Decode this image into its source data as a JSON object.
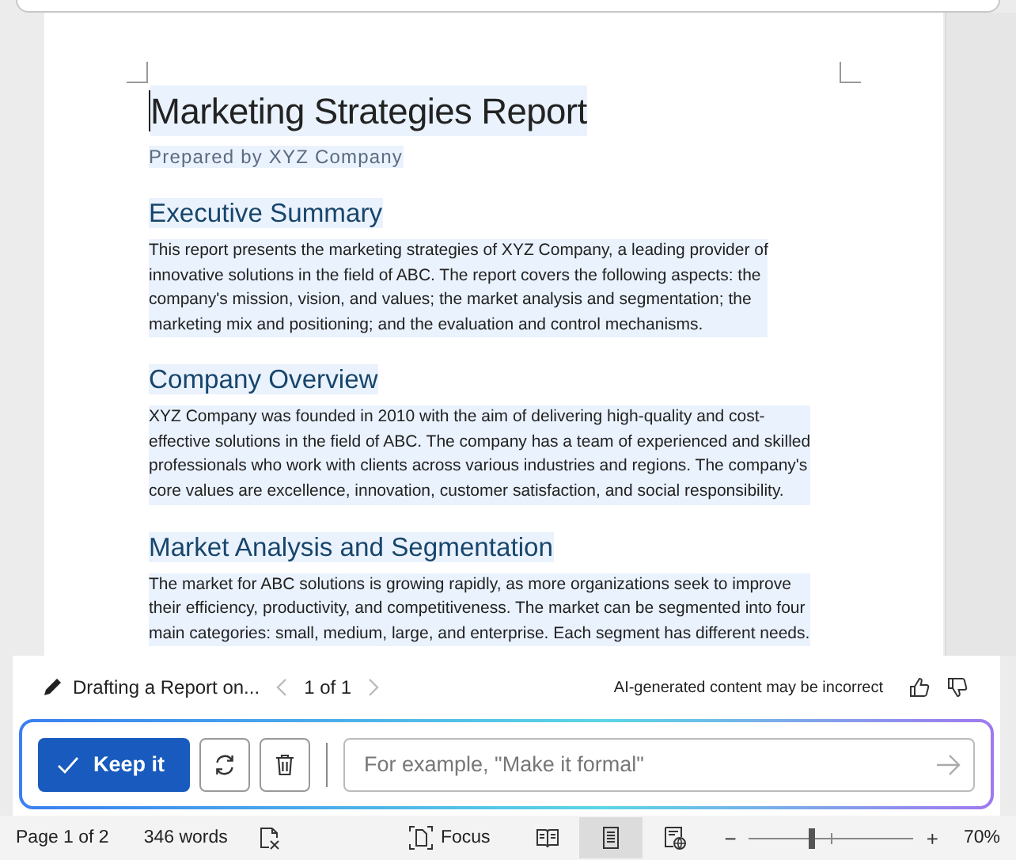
{
  "document": {
    "title": "Marketing Strategies Report",
    "subtitle": "Prepared by XYZ Company",
    "sections": [
      {
        "heading": "Executive Summary",
        "lines": [
          "This report presents the marketing strategies of XYZ Company, a leading provider of",
          "innovative solutions in the field of ABC. The report covers the following aspects: the",
          "company's mission, vision, and values; the market analysis and segmentation; the",
          "marketing mix and positioning; and the evaluation and control mechanisms."
        ]
      },
      {
        "heading": "Company Overview",
        "lines": [
          "XYZ Company was founded in 2010 with the aim of delivering high-quality and cost-",
          "effective solutions in the field of ABC. The company has a team of experienced and skilled",
          "professionals who work with clients across various industries and regions. The company's",
          "core values are excellence, innovation, customer satisfaction, and social responsibility."
        ]
      },
      {
        "heading": "Market Analysis and Segmentation",
        "lines": [
          "The market for ABC solutions is growing rapidly, as more organizations seek to improve",
          "their efficiency, productivity, and competitiveness. The market can be segmented into four",
          "main categories: small, medium, large, and enterprise. Each segment has different needs."
        ]
      }
    ]
  },
  "copilot": {
    "draft_title": "Drafting a Report on...",
    "pager": "1 of 1",
    "prev_disabled": true,
    "next_disabled": true,
    "disclaimer": "AI-generated content may be incorrect",
    "keep_label": "Keep it",
    "prompt": {
      "placeholder": "For example, \"Make it formal\""
    }
  },
  "status_bar": {
    "page": "Page 1 of 2",
    "words": "346 words",
    "focus": "Focus",
    "views": [
      {
        "kind": "read",
        "selected": false
      },
      {
        "kind": "print",
        "selected": true
      },
      {
        "kind": "web",
        "selected": false
      }
    ],
    "zoom": {
      "minus": "−",
      "plus": "+",
      "level": 0.38,
      "reading": "70%"
    }
  }
}
